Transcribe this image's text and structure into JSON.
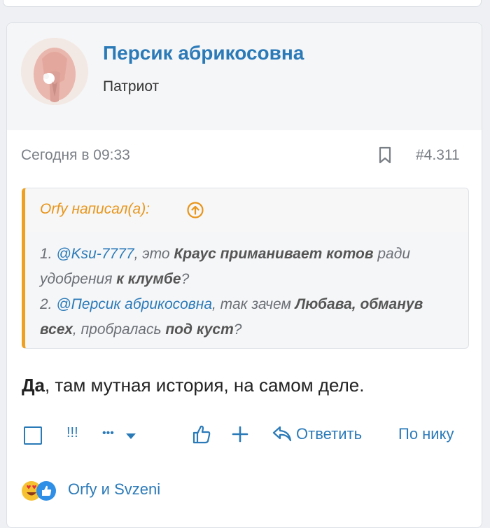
{
  "post": {
    "username": "Персик абрикосовна",
    "user_title": "Патриот",
    "date": "Сегодня в 09:33",
    "number": "#4.311"
  },
  "quote": {
    "author": "Orfy написал(а):",
    "line1": {
      "num": "1. ",
      "mention": "@Ksu-7777",
      "t1": ", это ",
      "b1": "Краус приманивает котов",
      "t2": " ради удобрения ",
      "b2": "к клумбе",
      "t3": "?"
    },
    "line2": {
      "num": "2. ",
      "mention": "@Персик абрикосовна",
      "t1": ", так зачем ",
      "b1": "Любава, обманув всех",
      "t2": ", пробралась ",
      "b2": "под куст",
      "t3": "?"
    }
  },
  "message": {
    "bold": "Да",
    "rest": ", там мутная история, на самом деле."
  },
  "actions": {
    "exclaim": "!!!",
    "more": "•••",
    "reply": "Ответить",
    "by_nick": "По нику"
  },
  "reactions": {
    "users": "Orfy и Svzeni",
    "icons": [
      "heart-eyes-emoji",
      "thumbs-up-emoji"
    ]
  },
  "colors": {
    "accent": "#2b7ab8",
    "quote_border": "#f0a020"
  }
}
